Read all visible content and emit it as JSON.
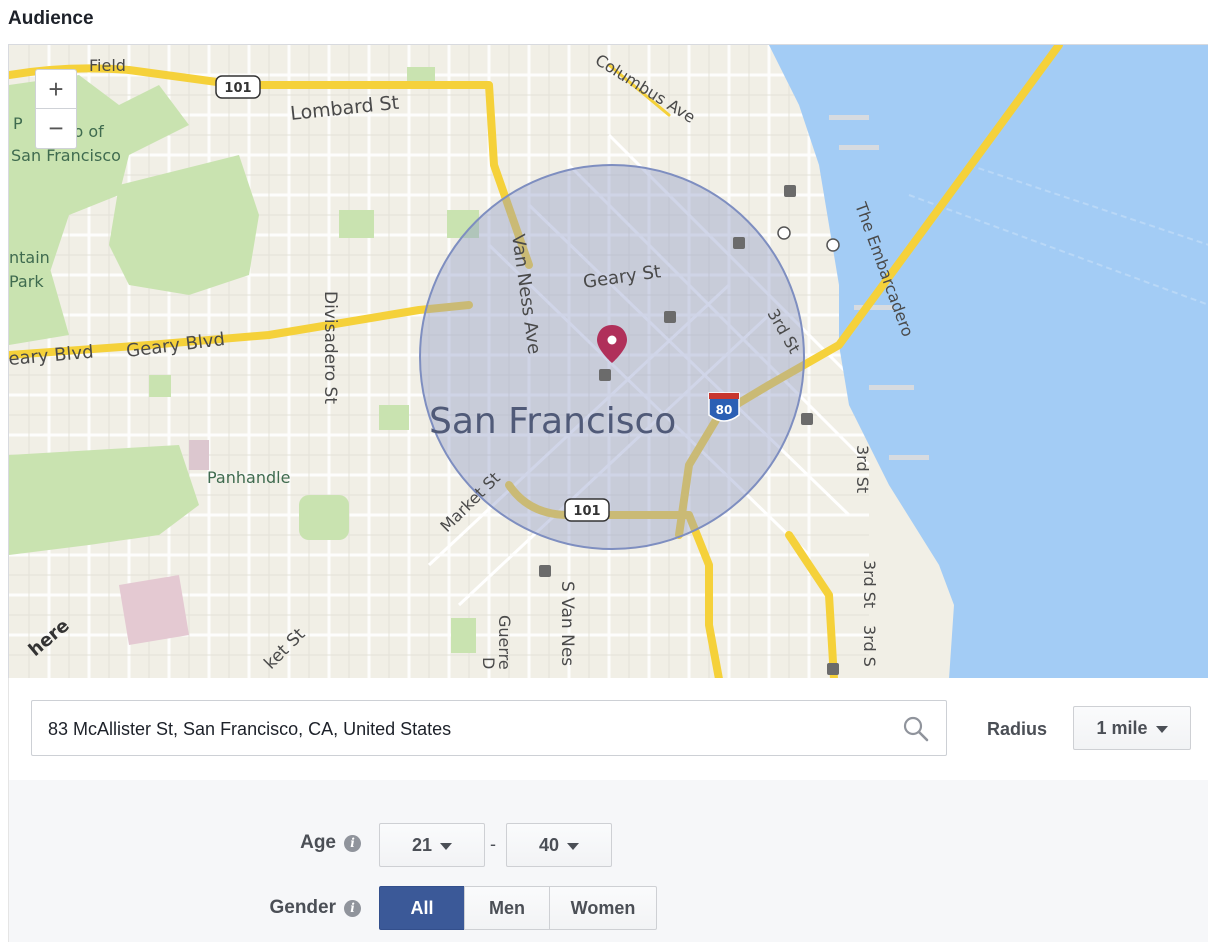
{
  "audience": {
    "title": "Audience"
  },
  "map": {
    "city_label": "San Francisco",
    "watermark": "here",
    "labels": {
      "field": "Field",
      "presidio_1": "P",
      "presidio_2": "io of",
      "presidio_3": "San Francisco",
      "mountain": "ntain",
      "park": "Park",
      "panhandle": "Panhandle",
      "lombard": "Lombard St",
      "columbus": "Columbus Ave",
      "geary_blvd_1": "eary Blvd",
      "geary_blvd_2": "Geary Blvd",
      "geary_st": "Geary St",
      "van_ness": "Van Ness Ave",
      "s_van_ness": "S Van Nes",
      "divisadero": "Divisadero St",
      "market_1": "Market St",
      "market_2": "ket St",
      "third_1": "3rd St",
      "third_2": "3rd St",
      "third_3": "3rd St",
      "third_4": "3rd S",
      "embarcadero": "The Embarcadero",
      "guerrero": "Guerre",
      "d_label": "D",
      "hwy_101_a": "101",
      "hwy_101_b": "101",
      "i80": "80"
    },
    "zoom_in": "+",
    "zoom_out": "−",
    "colors": {
      "water": "#a3ccf5",
      "radius_fill": "#8e9cc8",
      "pin": "#b0305a",
      "highway": "#f5d13a",
      "park": "#c9e3b0"
    }
  },
  "location": {
    "value": "83 McAllister St, San Francisco, CA, United States",
    "radius_label": "Radius",
    "radius_value": "1 mile"
  },
  "age": {
    "label": "Age",
    "from": "21",
    "to": "40",
    "separator": "-"
  },
  "gender": {
    "label": "Gender",
    "options": [
      "All",
      "Men",
      "Women"
    ],
    "selected": "All"
  },
  "accent_color": "#3b5998"
}
